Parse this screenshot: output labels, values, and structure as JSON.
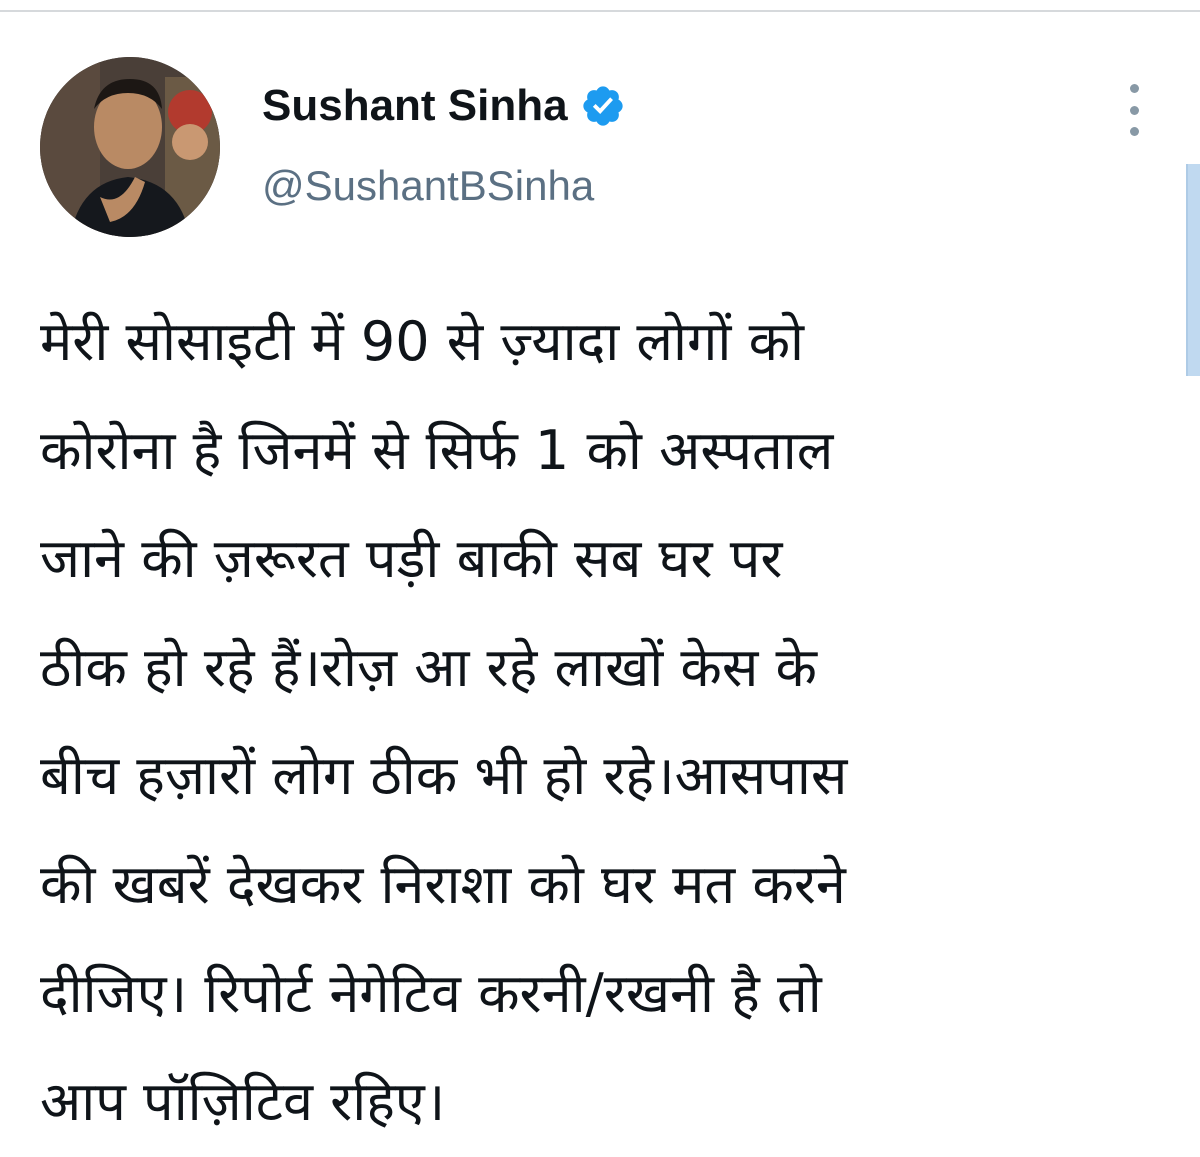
{
  "author": {
    "display_name": "Sushant Sinha",
    "handle": "@SushantBSinha",
    "verified": true
  },
  "tweet": {
    "lines": [
      "मेरी सोसाइटी में 90 से ज़्यादा लोगों को",
      "कोरोना है जिनमें से सिर्फ 1 को अस्पताल",
      "जाने की ज़रूरत पड़ी बाकी सब घर पर",
      "ठीक हो रहे हैं।रोज़ आ रहे लाखों केस के",
      "बीच हज़ारों लोग ठीक भी हो रहे।आसपास",
      "की खबरें देखकर निराशा को घर मत करने",
      "दीजिए। रिपोर्ट नेगेटिव करनी/रखनी है तो",
      "आप पॉज़िटिव रहिए।"
    ]
  },
  "icons": {
    "verified": "verified-badge-icon",
    "more": "more-vertical-icon"
  },
  "colors": {
    "verified_blue": "#1d9bf0",
    "text_primary": "#0f1419",
    "text_secondary": "#5b7083",
    "divider": "#d6d9dc",
    "scrollbar": "#c0d9f0"
  }
}
